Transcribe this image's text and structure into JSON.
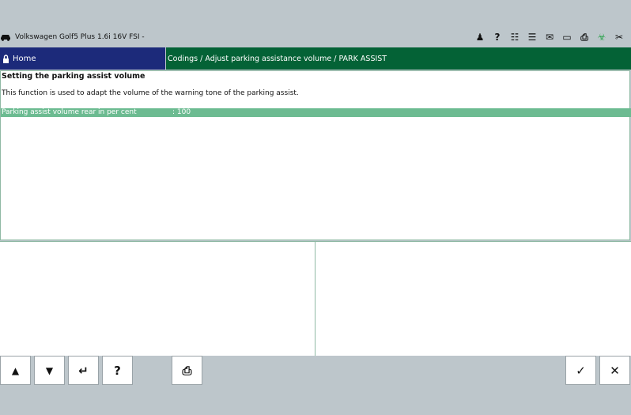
{
  "header": {
    "vehicle": "Volkswagen Golf5 Plus 1.6i 16V FSI -",
    "tools": [
      {
        "name": "person-tw-icon",
        "glyph": "♟"
      },
      {
        "name": "help-icon",
        "glyph": "?"
      },
      {
        "name": "cart-icon",
        "glyph": "☷"
      },
      {
        "name": "tree-icon",
        "glyph": "☰"
      },
      {
        "name": "mail-icon",
        "glyph": "✉"
      },
      {
        "name": "battery-icon",
        "glyph": "▭"
      },
      {
        "name": "print-icon",
        "glyph": "⎙"
      },
      {
        "name": "diagnosis-icon",
        "glyph": "☣"
      },
      {
        "name": "connection-icon",
        "glyph": "✂"
      }
    ]
  },
  "nav": {
    "home": "Home",
    "breadcrumb": "Codings / Adjust parking assistance volume / PARK ASSIST"
  },
  "content": {
    "title": "Setting the parking assist volume",
    "description": "This function is used to adapt the volume of the warning tone of the parking assist.",
    "row_label": "Parking assist volume rear in per cent",
    "row_value": ": 100"
  },
  "buttons": {
    "up": "▲",
    "down": "▼",
    "enter": "↵",
    "help": "?",
    "print": "⎙",
    "ok": "✓",
    "cancel": "✕"
  },
  "colors": {
    "home_bg": "#1c2a7a",
    "breadcrumb_bg": "#046236",
    "value_row_bg": "#6cbb91",
    "background": "#bdc6cb"
  }
}
